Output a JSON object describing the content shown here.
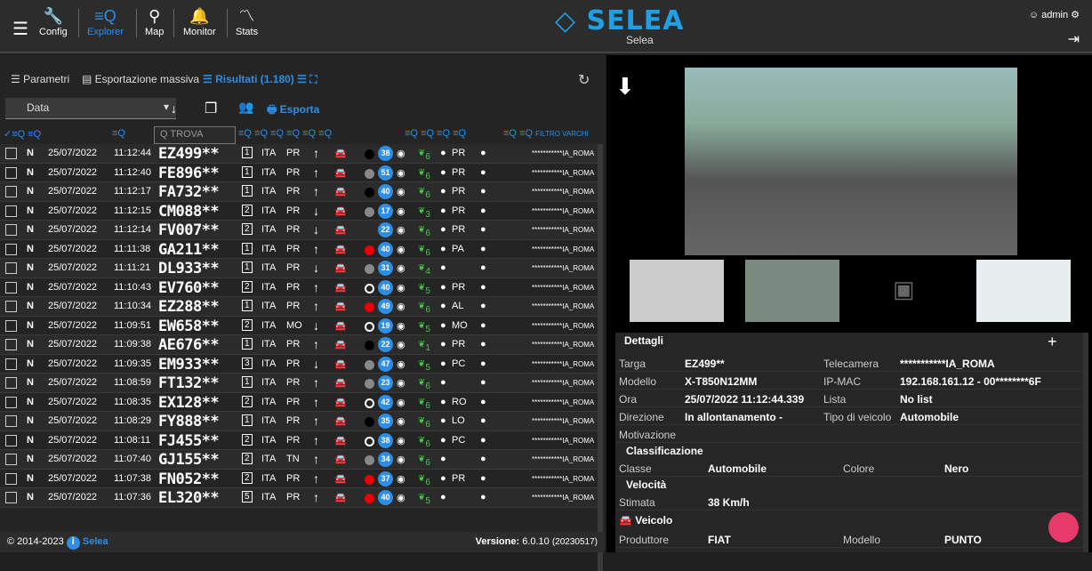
{
  "nav": {
    "config": "Config",
    "explorer": "Explorer",
    "map": "Map",
    "monitor": "Monitor",
    "stats": "Stats"
  },
  "brand": {
    "logo": "SELEA",
    "sub": "Selea"
  },
  "user": {
    "name": "admin"
  },
  "tabs": {
    "params": "Parametri",
    "export": "Esportazione massiva",
    "results": "Risultati (1.180)"
  },
  "toolbar": {
    "sort": "Data",
    "export": "Esporta",
    "search_placeholder": "TROVA",
    "filter": "FILTRO VARCHI"
  },
  "rows": [
    {
      "flag": "N",
      "date": "25/07/2022",
      "time": "11:12:44",
      "plate": "EZ499**",
      "lane": "1",
      "country": "ITA",
      "prov": "PR",
      "dir": "↑",
      "speed": "38",
      "color": "#000",
      "cam": "***********IA_ROMA",
      "ecoval": "6",
      "reg": "PR"
    },
    {
      "flag": "N",
      "date": "25/07/2022",
      "time": "11:12:40",
      "plate": "FE896**",
      "lane": "1",
      "country": "ITA",
      "prov": "PR",
      "dir": "↑",
      "speed": "51",
      "color": "#888",
      "cam": "***********IA_ROMA",
      "ecoval": "6",
      "reg": "PR"
    },
    {
      "flag": "N",
      "date": "25/07/2022",
      "time": "11:12:17",
      "plate": "FA732**",
      "lane": "1",
      "country": "ITA",
      "prov": "PR",
      "dir": "↑",
      "speed": "40",
      "color": "#000",
      "cam": "***********IA_ROMA",
      "ecoval": "6",
      "reg": "PR"
    },
    {
      "flag": "N",
      "date": "25/07/2022",
      "time": "11:12:15",
      "plate": "CM088**",
      "lane": "2",
      "country": "ITA",
      "prov": "PR",
      "dir": "↓",
      "speed": "17",
      "color": "#888",
      "cam": "***********IA_ROMA",
      "ecoval": "3",
      "reg": "PR"
    },
    {
      "flag": "N",
      "date": "25/07/2022",
      "time": "11:12:14",
      "plate": "FV007**",
      "lane": "2",
      "country": "ITA",
      "prov": "PR",
      "dir": "↓",
      "speed": "22",
      "color": "",
      "cam": "***********IA_ROMA",
      "ecoval": "6",
      "reg": "PR"
    },
    {
      "flag": "N",
      "date": "25/07/2022",
      "time": "11:11:38",
      "plate": "GA211**",
      "lane": "1",
      "country": "ITA",
      "prov": "PR",
      "dir": "↑",
      "speed": "40",
      "color": "#e00",
      "cam": "***********IA_ROMA",
      "ecoval": "6",
      "reg": "PA"
    },
    {
      "flag": "N",
      "date": "25/07/2022",
      "time": "11:11:21",
      "plate": "DL933**",
      "lane": "1",
      "country": "ITA",
      "prov": "PR",
      "dir": "↓",
      "speed": "31",
      "color": "#888",
      "cam": "***********IA_ROMA",
      "ecoval": "4",
      "reg": ""
    },
    {
      "flag": "N",
      "date": "25/07/2022",
      "time": "11:10:43",
      "plate": "EV760**",
      "lane": "2",
      "country": "ITA",
      "prov": "PR",
      "dir": "↑",
      "speed": "40",
      "color": "#fff",
      "cam": "***********IA_ROMA",
      "ecoval": "5",
      "reg": "PR"
    },
    {
      "flag": "N",
      "date": "25/07/2022",
      "time": "11:10:34",
      "plate": "EZ288**",
      "lane": "1",
      "country": "ITA",
      "prov": "PR",
      "dir": "↑",
      "speed": "49",
      "color": "#e00",
      "cam": "***********IA_ROMA",
      "ecoval": "6",
      "reg": "AL"
    },
    {
      "flag": "N",
      "date": "25/07/2022",
      "time": "11:09:51",
      "plate": "EW658**",
      "lane": "2",
      "country": "ITA",
      "prov": "MO",
      "dir": "↓",
      "speed": "19",
      "color": "#fff",
      "cam": "***********IA_ROMA",
      "ecoval": "5",
      "reg": "MO"
    },
    {
      "flag": "N",
      "date": "25/07/2022",
      "time": "11:09:38",
      "plate": "AE676**",
      "lane": "1",
      "country": "ITA",
      "prov": "PR",
      "dir": "↑",
      "speed": "22",
      "color": "#000",
      "cam": "***********IA_ROMA",
      "ecoval": "1",
      "reg": "PR"
    },
    {
      "flag": "N",
      "date": "25/07/2022",
      "time": "11:09:35",
      "plate": "EM933**",
      "lane": "3",
      "country": "ITA",
      "prov": "PR",
      "dir": "↓",
      "speed": "47",
      "color": "#888",
      "cam": "***********IA_ROMA",
      "ecoval": "5",
      "reg": "PC"
    },
    {
      "flag": "N",
      "date": "25/07/2022",
      "time": "11:08:59",
      "plate": "FT132**",
      "lane": "1",
      "country": "ITA",
      "prov": "PR",
      "dir": "↑",
      "speed": "23",
      "color": "#888",
      "cam": "***********IA_ROMA",
      "ecoval": "6",
      "reg": ""
    },
    {
      "flag": "N",
      "date": "25/07/2022",
      "time": "11:08:35",
      "plate": "EX128**",
      "lane": "2",
      "country": "ITA",
      "prov": "PR",
      "dir": "↑",
      "speed": "42",
      "color": "#fff",
      "cam": "***********IA_ROMA",
      "ecoval": "6",
      "reg": "RO"
    },
    {
      "flag": "N",
      "date": "25/07/2022",
      "time": "11:08:29",
      "plate": "FY888**",
      "lane": "1",
      "country": "ITA",
      "prov": "PR",
      "dir": "↑",
      "speed": "35",
      "color": "#000",
      "cam": "***********IA_ROMA",
      "ecoval": "6",
      "reg": "LO"
    },
    {
      "flag": "N",
      "date": "25/07/2022",
      "time": "11:08:11",
      "plate": "FJ455**",
      "lane": "2",
      "country": "ITA",
      "prov": "PR",
      "dir": "↑",
      "speed": "38",
      "color": "#fff",
      "cam": "***********IA_ROMA",
      "ecoval": "6",
      "reg": "PC"
    },
    {
      "flag": "N",
      "date": "25/07/2022",
      "time": "11:07:40",
      "plate": "GJ155**",
      "lane": "2",
      "country": "ITA",
      "prov": "TN",
      "dir": "↑",
      "speed": "34",
      "color": "#888",
      "cam": "***********IA_ROMA",
      "ecoval": "6",
      "reg": ""
    },
    {
      "flag": "N",
      "date": "25/07/2022",
      "time": "11:07:38",
      "plate": "FN052**",
      "lane": "2",
      "country": "ITA",
      "prov": "PR",
      "dir": "↑",
      "speed": "37",
      "color": "#e00",
      "cam": "***********IA_ROMA",
      "ecoval": "6",
      "reg": "PR"
    },
    {
      "flag": "N",
      "date": "25/07/2022",
      "time": "11:07:36",
      "plate": "EL320**",
      "lane": "5",
      "country": "ITA",
      "prov": "PR",
      "dir": "↑",
      "speed": "40",
      "color": "#e00",
      "cam": "***********IA_ROMA",
      "ecoval": "5",
      "reg": ""
    }
  ],
  "footer": {
    "copy": "© 2014-2023",
    "brand": "Selea",
    "version_label": "Versione:",
    "version": "6.0.10",
    "build": "(20230517)"
  },
  "details": {
    "title": "Dettagli",
    "targa_l": "Targa",
    "targa": "EZ499**",
    "tele_l": "Telecamera",
    "tele": "***********IA_ROMA",
    "mod_l": "Modello",
    "mod": "X-T850N12MM",
    "ip_l": "IP-MAC",
    "ip": "192.168.161.12 - 00********6F",
    "ora_l": "Ora",
    "ora": "25/07/2022 11:12:44.339",
    "lista_l": "Lista",
    "lista": "No list",
    "dir_l": "Direzione",
    "dir": "In allontanamento -",
    "tipo_l": "Tipo di veicolo",
    "tipo": "Automobile",
    "mot_l": "Motivazione",
    "class_h": "Classificazione",
    "classe_l": "Classe",
    "classe": "Automobile",
    "col_l": "Colore",
    "col": "Nero",
    "vel_h": "Velocità",
    "stim_l": "Stimata",
    "stim": "38 Km/h",
    "veic_h": "Veicolo",
    "prod_l": "Produttore",
    "prod": "FIAT",
    "mod2_l": "Modello",
    "mod2": "PUNTO"
  }
}
